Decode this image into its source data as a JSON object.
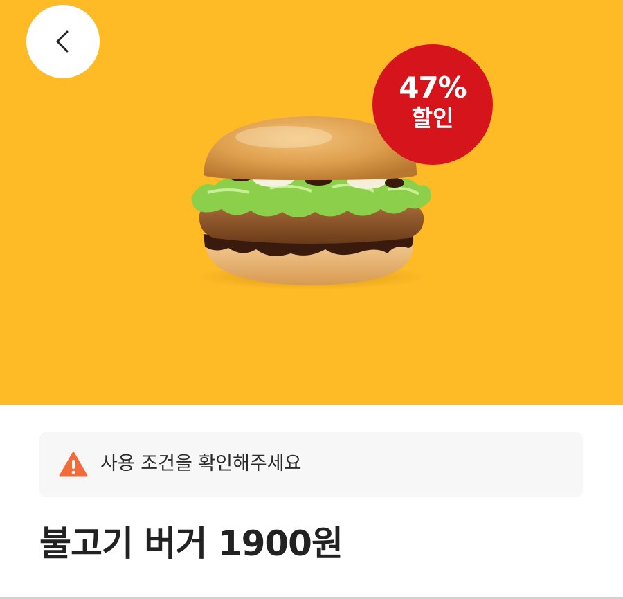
{
  "header": {
    "back_icon": "chevron-left-icon"
  },
  "hero": {
    "background_color": "#FEBB26",
    "badge": {
      "percent": "47%",
      "label": "할인",
      "color": "#D6141C"
    }
  },
  "notice": {
    "icon": "warning-icon",
    "icon_color": "#F26B3A",
    "text": "사용 조건을 확인해주세요"
  },
  "product": {
    "title": "불고기 버거 1900원"
  }
}
